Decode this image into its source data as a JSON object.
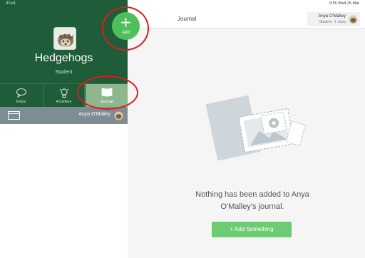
{
  "status": {
    "left": "iPad",
    "right": "9:55   Wed 25 Mar"
  },
  "sidebar": {
    "class_name": "Hedgehogs",
    "class_role": "Student",
    "add_label": "Add",
    "tabs": [
      {
        "label": "Inbox"
      },
      {
        "label": "Activities"
      },
      {
        "label": "Journal"
      }
    ],
    "student_name": "Anya O'Malley"
  },
  "main": {
    "title": "Journal",
    "user": {
      "name": "Anya O'Malley",
      "role": "Student · 1 class"
    },
    "empty_message_line1": "Nothing has been added to Anya",
    "empty_message_line2": "O'Malley's journal.",
    "add_button": "+ Add Something"
  },
  "colors": {
    "sidebar_green": "#1e5c3a",
    "active_tab": "#8fb78e",
    "add_circle": "#4fbf5c",
    "add_button": "#6dcc73",
    "student_row": "#7e8c93",
    "annotation": "#e01b1b"
  },
  "icons": [
    "plus-icon",
    "inbox-icon",
    "activities-icon",
    "journal-icon",
    "student-avatar-icon",
    "class-avatar-icon",
    "empty-journal-illustration"
  ]
}
